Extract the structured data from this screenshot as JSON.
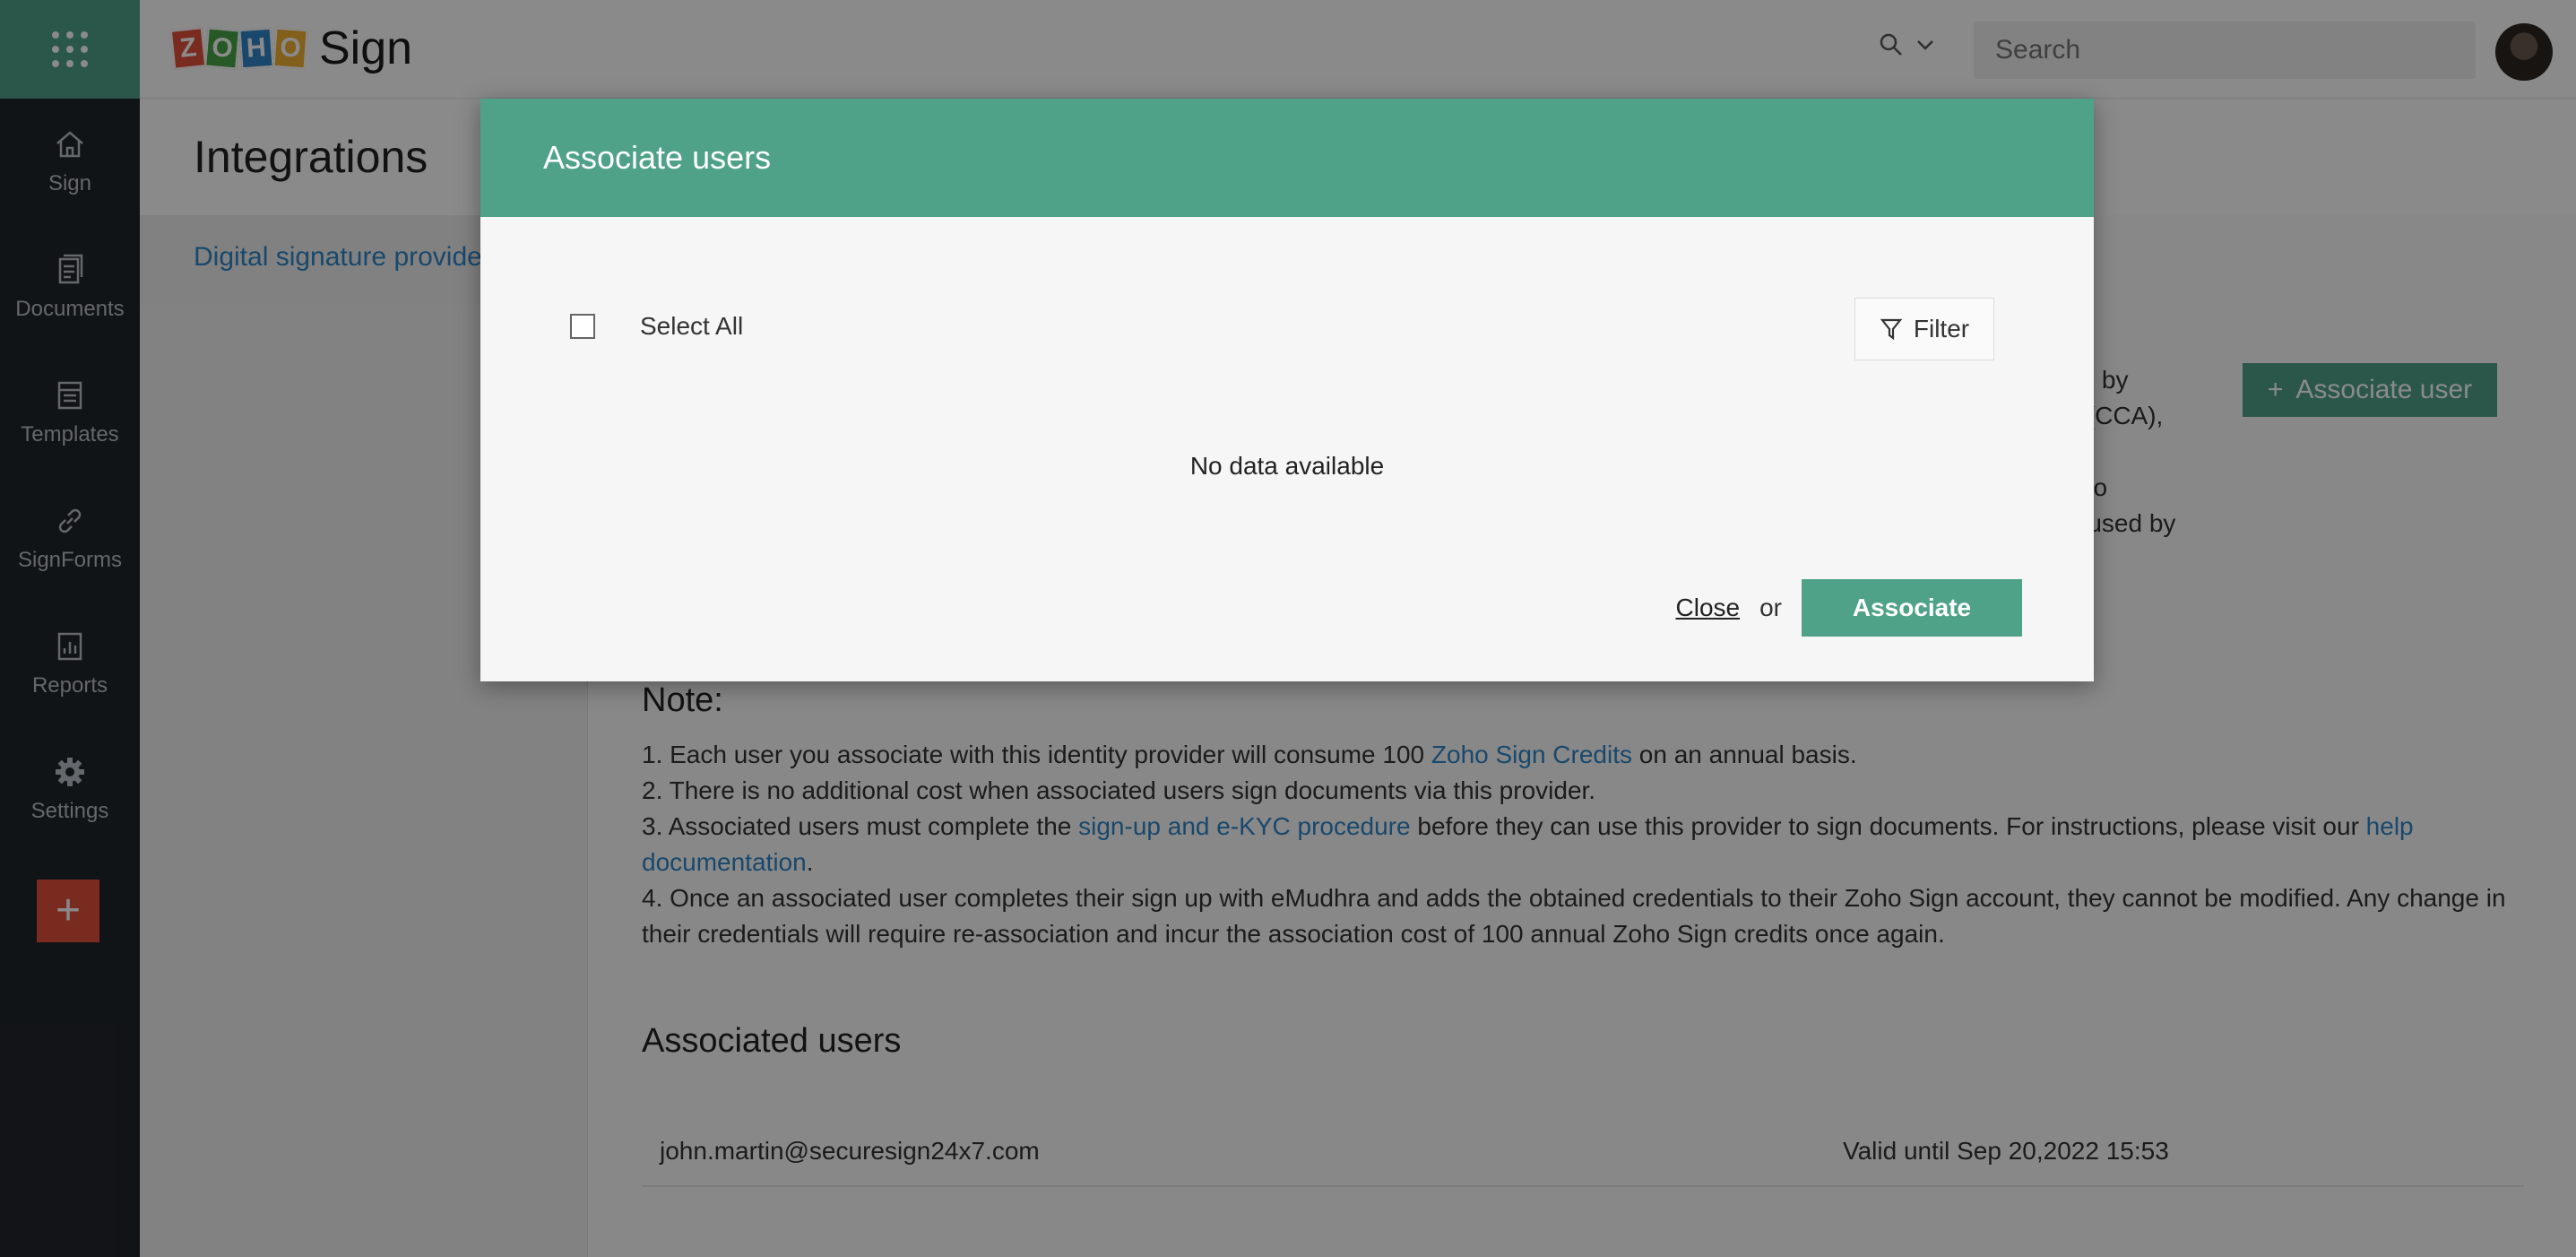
{
  "app": {
    "logo_letters": [
      "Z",
      "O",
      "H",
      "O"
    ],
    "product_name": "Sign"
  },
  "colors": {
    "accent": "#4fa287",
    "rail_bg": "#21252b",
    "plus_button": "#e2503b",
    "link": "#2f86c7",
    "zoho_z": "#e2503b",
    "zoho_o1": "#47a447",
    "zoho_h": "#2f86c7",
    "zoho_o2": "#f0b030"
  },
  "sidebar": {
    "items": [
      {
        "label": "Sign",
        "icon": "home-icon"
      },
      {
        "label": "Documents",
        "icon": "documents-icon"
      },
      {
        "label": "Templates",
        "icon": "templates-icon"
      },
      {
        "label": "SignForms",
        "icon": "link-icon"
      },
      {
        "label": "Reports",
        "icon": "reports-icon"
      },
      {
        "label": "Settings",
        "icon": "gear-icon"
      }
    ],
    "plus_label": "+"
  },
  "header": {
    "search_placeholder": "Search"
  },
  "page": {
    "title": "Integrations",
    "subnav_link": "Digital signature provide",
    "associate_user_button": "Associate user",
    "partial_text": [
      "ed by",
      "s (CCA),",
      "s to",
      "e used by"
    ],
    "note_title": "Note:",
    "notes": {
      "n1_a": "1. Each user you associate with this identity provider will consume 100 ",
      "n1_link": "Zoho Sign Credits",
      "n1_b": " on an annual basis.",
      "n2": "2. There is no additional cost when associated users sign documents via this provider.",
      "n3_a": "3. Associated users must complete the ",
      "n3_link1": "sign-up and e-KYC procedure",
      "n3_b": " before they can use this provider to sign documents. For instructions, please visit our ",
      "n3_link2": "help documentation",
      "n3_c": ".",
      "n4": "4. Once an associated user completes their sign up with eMudhra and adds the obtained credentials to their Zoho Sign account, they cannot be modified. Any change in their credentials will require re-association and incur the association cost of 100 annual Zoho Sign credits once again."
    },
    "associated_users_title": "Associated users",
    "associated_users": [
      {
        "email": "john.martin@securesign24x7.com",
        "valid": "Valid until Sep 20,2022 15:53"
      }
    ]
  },
  "modal": {
    "title": "Associate users",
    "select_all": "Select All",
    "filter": "Filter",
    "empty": "No data available",
    "close": "Close",
    "or": "or",
    "associate": "Associate"
  }
}
